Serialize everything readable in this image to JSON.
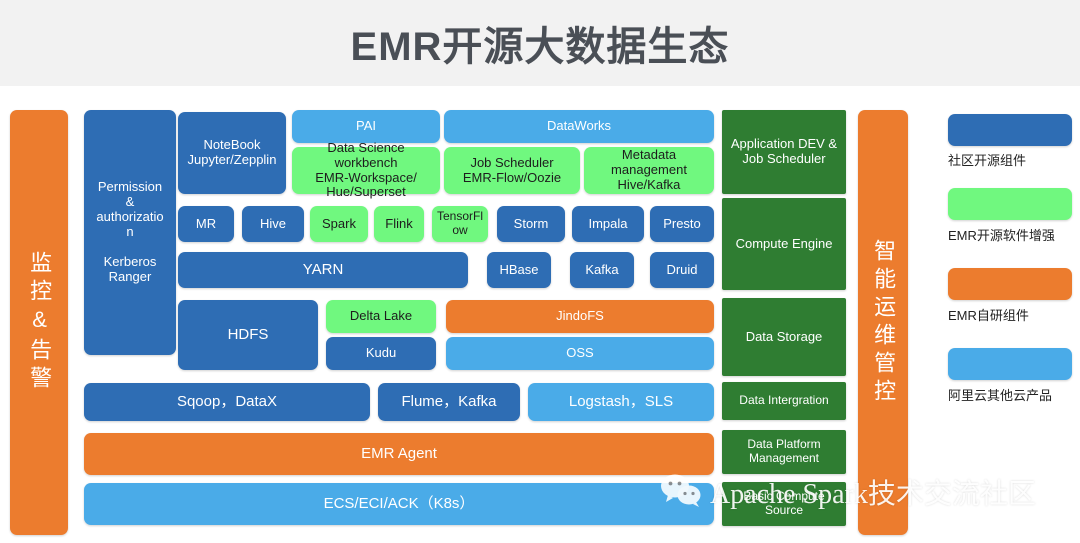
{
  "header": {
    "title": "EMR开源大数据生态"
  },
  "left_bar": {
    "label": "监控&告警"
  },
  "right_bar": {
    "label": "智能运维管控"
  },
  "security": {
    "label": "Permission\n&\nauthorizatio\nn\n\nKerberos\nRanger"
  },
  "boxes": [
    {
      "name": "notebook",
      "label": "NoteBook\nJupyter/Zepplin",
      "color": "blue"
    },
    {
      "name": "pai",
      "label": "PAI",
      "color": "ltblue"
    },
    {
      "name": "dataworks",
      "label": "DataWorks",
      "color": "ltblue"
    },
    {
      "name": "data-science-workbench",
      "label": "Data Science workbench\nEMR-Workspace/\nHue/Superset",
      "color": "green"
    },
    {
      "name": "job-scheduler",
      "label": "Job Scheduler\nEMR-Flow/Oozie",
      "color": "green"
    },
    {
      "name": "metadata-management",
      "label": "Metadata\nmanagement\nHive/Kafka",
      "color": "green"
    },
    {
      "name": "mr",
      "label": "MR",
      "color": "blue"
    },
    {
      "name": "hive",
      "label": "Hive",
      "color": "blue"
    },
    {
      "name": "spark",
      "label": "Spark",
      "color": "green"
    },
    {
      "name": "flink",
      "label": "Flink",
      "color": "green"
    },
    {
      "name": "tensorflow",
      "label": "TensorFl\now",
      "color": "green"
    },
    {
      "name": "storm",
      "label": "Storm",
      "color": "blue"
    },
    {
      "name": "impala",
      "label": "Impala",
      "color": "blue"
    },
    {
      "name": "presto",
      "label": "Presto",
      "color": "blue"
    },
    {
      "name": "yarn",
      "label": "YARN",
      "color": "blue"
    },
    {
      "name": "hbase",
      "label": "HBase",
      "color": "blue"
    },
    {
      "name": "kafka",
      "label": "Kafka",
      "color": "blue"
    },
    {
      "name": "druid",
      "label": "Druid",
      "color": "blue"
    },
    {
      "name": "hdfs",
      "label": "HDFS",
      "color": "blue"
    },
    {
      "name": "delta-lake",
      "label": "Delta Lake",
      "color": "green"
    },
    {
      "name": "jindofs",
      "label": "JindoFS",
      "color": "orange"
    },
    {
      "name": "kudu",
      "label": "Kudu",
      "color": "blue"
    },
    {
      "name": "oss",
      "label": "OSS",
      "color": "ltblue"
    },
    {
      "name": "sqoop-datax",
      "label": "Sqoop，DataX",
      "color": "blue"
    },
    {
      "name": "flume-kafka",
      "label": "Flume，Kafka",
      "color": "blue"
    },
    {
      "name": "logstash-sls",
      "label": "Logstash，SLS",
      "color": "ltblue"
    },
    {
      "name": "emr-agent",
      "label": "EMR Agent",
      "color": "orange"
    },
    {
      "name": "ecs-eci-ack",
      "label": "ECS/ECI/ACK（K8s）",
      "color": "ltblue"
    }
  ],
  "layers": [
    {
      "name": "application-dev-job-scheduler",
      "label": "Application DEV &\nJob Scheduler"
    },
    {
      "name": "compute-engine",
      "label": "Compute Engine"
    },
    {
      "name": "data-storage",
      "label": "Data Storage"
    },
    {
      "name": "data-intergration",
      "label": "Data Intergration"
    },
    {
      "name": "data-platform-management",
      "label": "Data Platform\nManagement"
    },
    {
      "name": "basic-compute-source",
      "label": "Basic Compute\nSource"
    }
  ],
  "legend": [
    {
      "name": "community-open-source",
      "label": "社区开源组件",
      "color": "#2e6db4"
    },
    {
      "name": "emr-enhanced",
      "label": "EMR开源软件增强",
      "color": "#70f87f"
    },
    {
      "name": "emr-proprietary",
      "label": "EMR自研组件",
      "color": "#ec7c2e"
    },
    {
      "name": "aliyun-other-products",
      "label": "阿里云其他云产品",
      "color": "#4aabe8"
    }
  ],
  "watermark": {
    "text": "Apache Spark技术交流社区",
    "icon": "wechat-icon"
  },
  "colors": {
    "blue": "#2e6db4",
    "green": "#70f87f",
    "orange": "#ec7c2e",
    "light_blue": "#4aabe8",
    "dark_green": "#2f7d32",
    "header_bg": "#f2f2f2",
    "title_text": "#4a4f56"
  }
}
